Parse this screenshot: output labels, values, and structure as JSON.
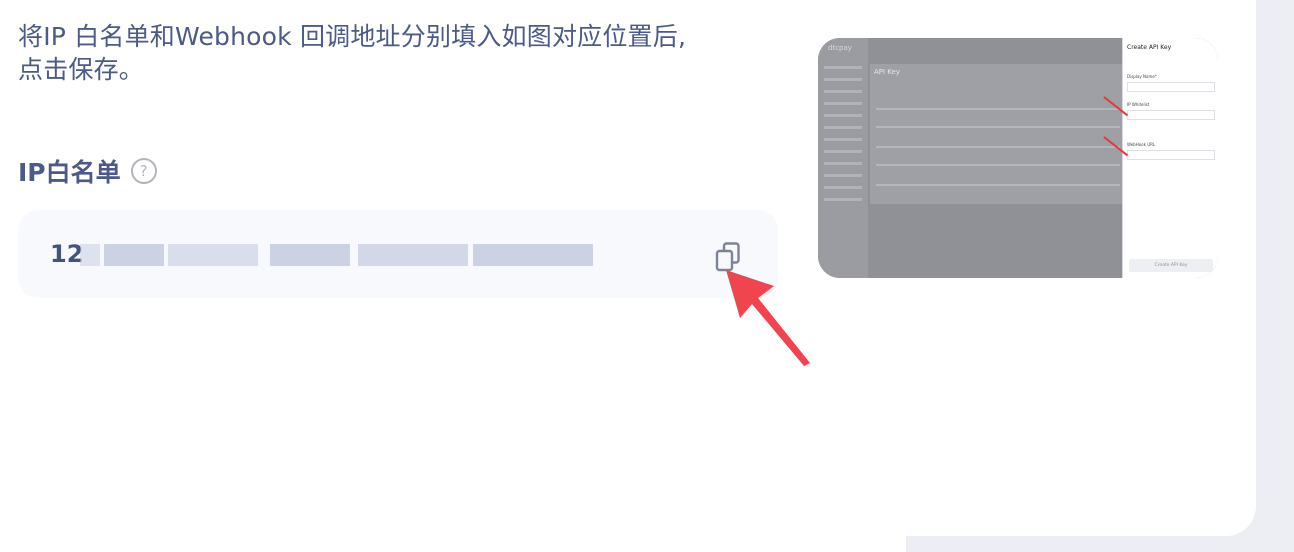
{
  "instruction": {
    "line1": "将IP 白名单和Webhook 回调地址分别填入如图对应位置后,",
    "line2": "点击保存。"
  },
  "ip_whitelist": {
    "title": "IP白名单",
    "help_icon": "question-mark-circle-icon",
    "value_visible": "12",
    "copy_icon": "copy-icon"
  },
  "preview": {
    "logo": "dtcpay",
    "page_title": "API Key",
    "panel_title": "Create API Key",
    "display_name_label": "Display Name*",
    "ip_whitelist_label": "IP Whitelist",
    "webhook_label": "WebHook URL",
    "create_button": "Create API Key"
  },
  "colors": {
    "text": "#4b5a86",
    "annotation_arrow": "#f0444e",
    "box_bg": "#f8f9fc"
  }
}
